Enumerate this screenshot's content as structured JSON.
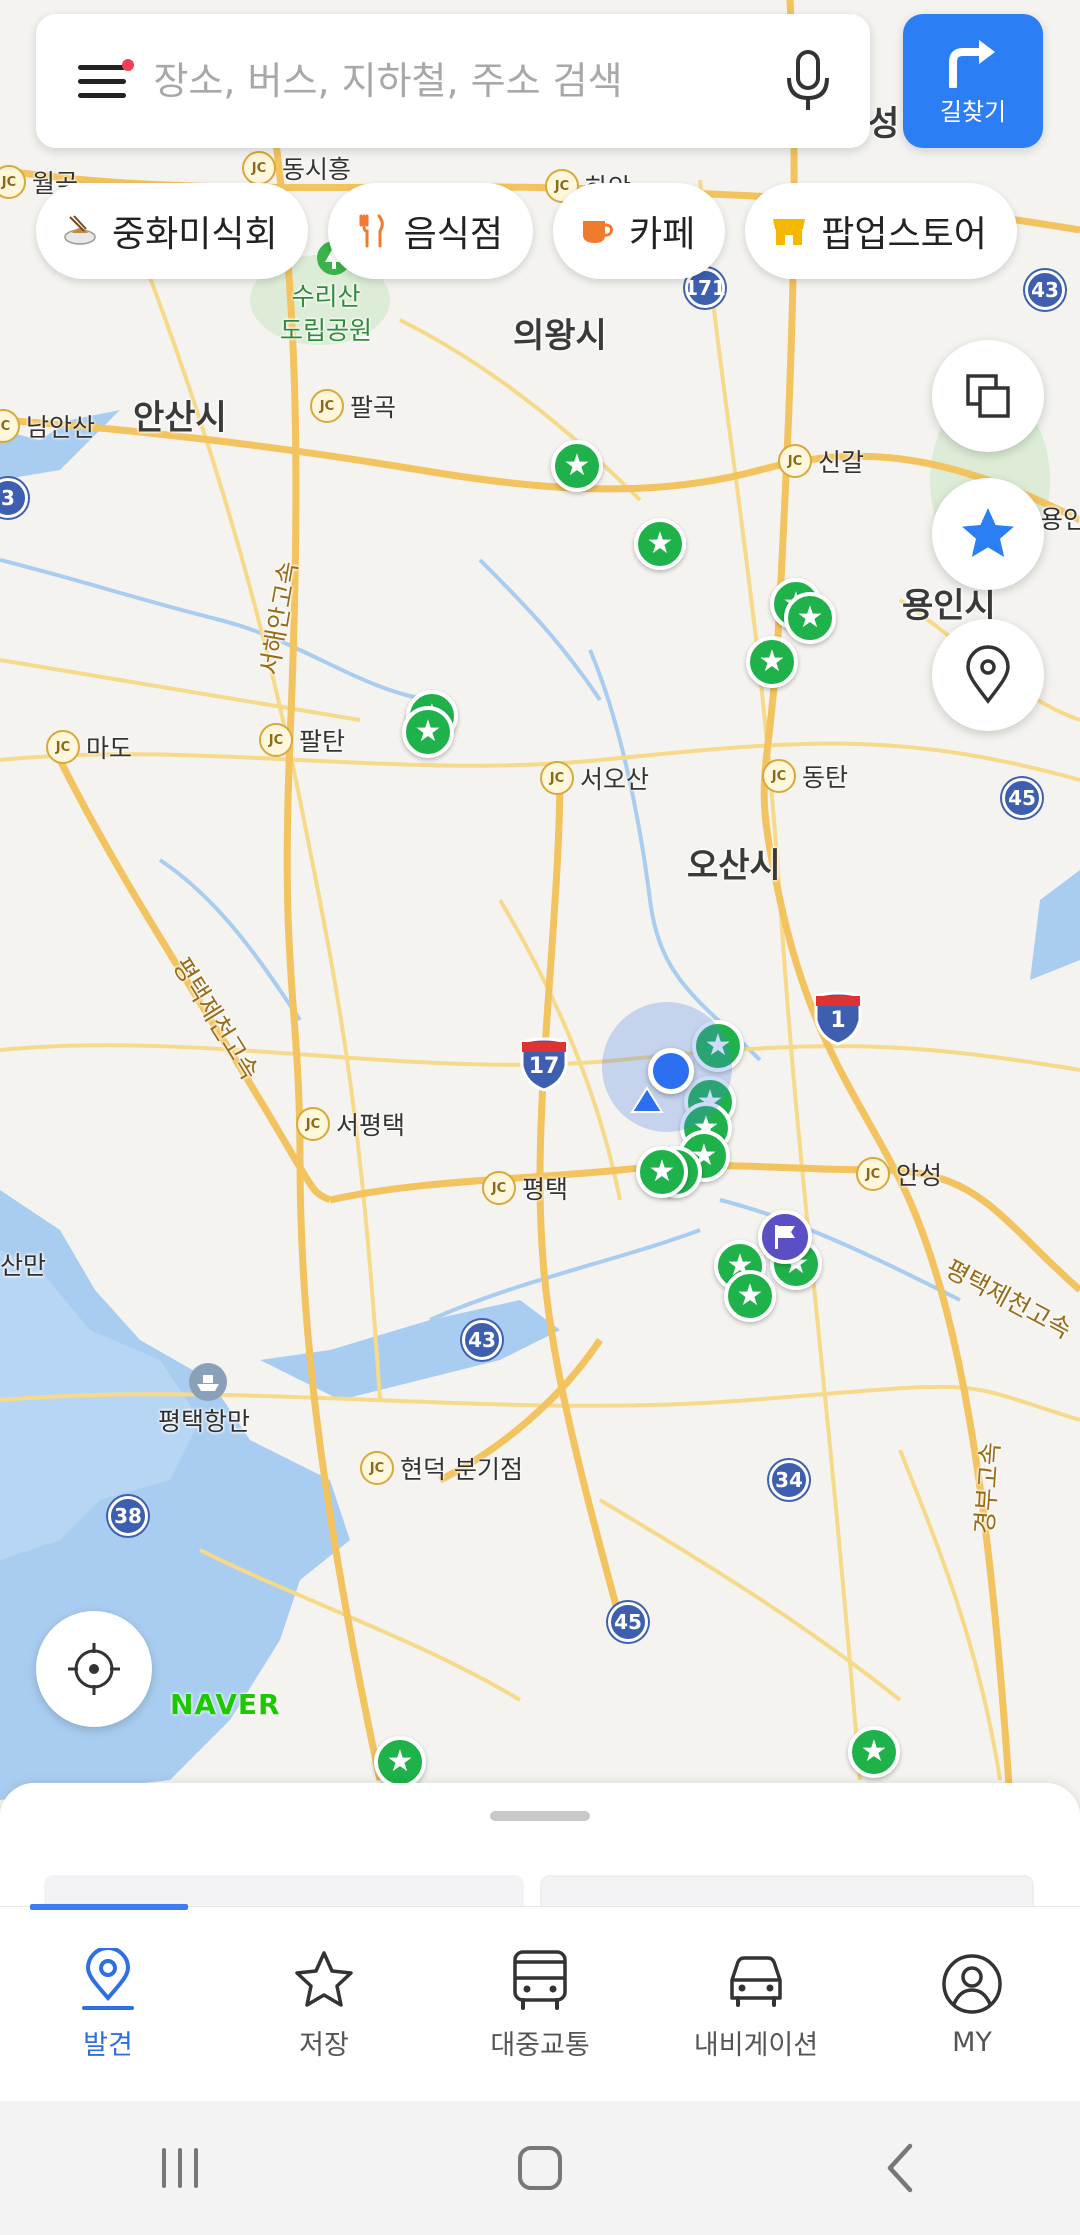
{
  "search": {
    "placeholder": "장소, 버스, 지하철, 주소 검색",
    "value": ""
  },
  "directions": {
    "label": "길찾기"
  },
  "chips": [
    {
      "label": "중화미식회",
      "icon": "dish-icon"
    },
    {
      "label": "음식점",
      "icon": "fork-knife-icon"
    },
    {
      "label": "카페",
      "icon": "coffee-cup-icon"
    },
    {
      "label": "팝업스토어",
      "icon": "store-icon"
    }
  ],
  "map": {
    "cities": [
      "의왕시",
      "안산시",
      "용인시",
      "오산시"
    ],
    "places": [
      "동시흥",
      "월곶",
      "하안",
      "신갈",
      "남안산",
      "팔곡",
      "마도",
      "팔탄",
      "서오산",
      "동탄",
      "서평택",
      "평택",
      "안성",
      "현덕 분기점",
      "평택항만",
      "산만",
      "성",
      "용인"
    ],
    "parks": [
      "수리산",
      "도립공원"
    ],
    "highway_labels": [
      "서해안고속",
      "평택제천고속",
      "평택제천고속",
      "경부고속"
    ],
    "route_numbers": [
      "43",
      "171",
      "3",
      "45",
      "1",
      "17",
      "43",
      "34",
      "38",
      "45"
    ],
    "jc_label": "JC",
    "brand_logo": "NAVER",
    "colors": {
      "land": "#f4f3ef",
      "water": "#a9cdf1",
      "road_major": "#f2c35e",
      "road_minor": "#f7d98a",
      "pin_green": "#1fb24a",
      "accent_blue": "#2c7ef5"
    }
  },
  "tabs": [
    {
      "label": "발견",
      "icon": "location-pin-icon",
      "active": true
    },
    {
      "label": "저장",
      "icon": "star-icon",
      "active": false
    },
    {
      "label": "대중교통",
      "icon": "bus-icon",
      "active": false
    },
    {
      "label": "내비게이션",
      "icon": "car-icon",
      "active": false
    },
    {
      "label": "MY",
      "icon": "profile-icon",
      "active": false
    }
  ],
  "system_nav": [
    "recent-apps-icon",
    "home-icon",
    "back-icon"
  ]
}
